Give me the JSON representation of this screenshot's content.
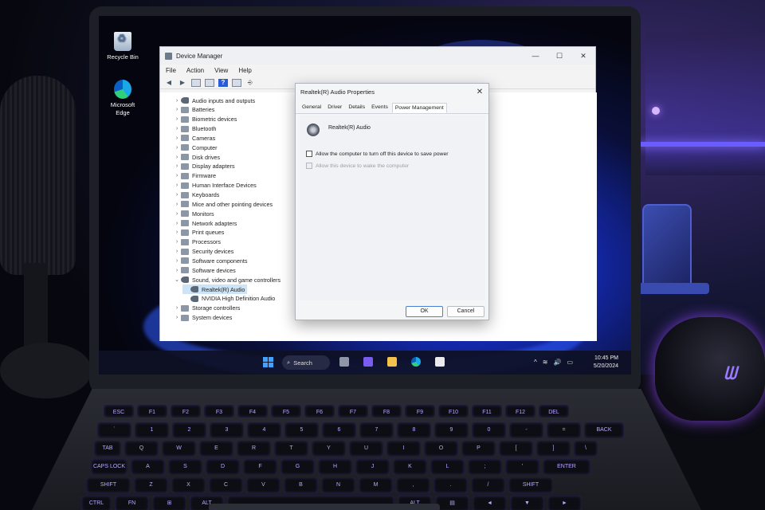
{
  "desktop": {
    "icons": [
      {
        "label": "Recycle Bin"
      },
      {
        "label": "Microsoft Edge"
      }
    ]
  },
  "device_manager": {
    "title": "Device Manager",
    "window_controls": {
      "minimize": "—",
      "maximize": "☐",
      "close": "✕"
    },
    "menu": [
      "File",
      "Action",
      "View",
      "Help"
    ],
    "tree": [
      {
        "label": "Audio inputs and outputs",
        "expander": "›"
      },
      {
        "label": "Batteries",
        "expander": "›"
      },
      {
        "label": "Biometric devices",
        "expander": "›"
      },
      {
        "label": "Bluetooth",
        "expander": "›"
      },
      {
        "label": "Cameras",
        "expander": "›"
      },
      {
        "label": "Computer",
        "expander": "›"
      },
      {
        "label": "Disk drives",
        "expander": "›"
      },
      {
        "label": "Display adapters",
        "expander": "›"
      },
      {
        "label": "Firmware",
        "expander": "›"
      },
      {
        "label": "Human Interface Devices",
        "expander": "›"
      },
      {
        "label": "Keyboards",
        "expander": "›"
      },
      {
        "label": "Mice and other pointing devices",
        "expander": "›"
      },
      {
        "label": "Monitors",
        "expander": "›"
      },
      {
        "label": "Network adapters",
        "expander": "›"
      },
      {
        "label": "Print queues",
        "expander": "›"
      },
      {
        "label": "Processors",
        "expander": "›"
      },
      {
        "label": "Security devices",
        "expander": "›"
      },
      {
        "label": "Software components",
        "expander": "›"
      },
      {
        "label": "Software devices",
        "expander": "›"
      },
      {
        "label": "Sound, video and game controllers",
        "expander": "⌄"
      },
      {
        "label": "Realtek(R) Audio",
        "expander": ""
      },
      {
        "label": "NVIDIA High Definition Audio",
        "expander": ""
      },
      {
        "label": "Storage controllers",
        "expander": "›"
      },
      {
        "label": "System devices",
        "expander": "›"
      }
    ]
  },
  "properties_dialog": {
    "title": "Realtek(R) Audio Properties",
    "close": "✕",
    "tabs": [
      "General",
      "Driver",
      "Details",
      "Events",
      "Power Management"
    ],
    "active_tab": "Power Management",
    "device_name": "Realtek(R) Audio",
    "options": [
      {
        "label": "Allow the computer to turn off this device to save power",
        "checked": false,
        "enabled": true
      },
      {
        "label": "Allow this device to wake the computer",
        "checked": false,
        "enabled": false
      }
    ],
    "ok_label": "OK",
    "cancel_label": "Cancel"
  },
  "taskbar": {
    "search_label": "Search",
    "tray_icons": [
      "^",
      "≋",
      "🔊",
      "▭"
    ],
    "time": "10:45 PM",
    "date": "5/20/2024"
  },
  "keyboard": {
    "rows": [
      [
        "ESC",
        "F1",
        "F2",
        "F3",
        "F4",
        "F5",
        "F6",
        "F7",
        "F8",
        "F9",
        "F10",
        "F11",
        "F12",
        "DEL"
      ],
      [
        "`",
        "1",
        "2",
        "3",
        "4",
        "5",
        "6",
        "7",
        "8",
        "9",
        "0",
        "-",
        "=",
        "BACK"
      ],
      [
        "TAB",
        "Q",
        "W",
        "E",
        "R",
        "T",
        "Y",
        "U",
        "I",
        "O",
        "P",
        "[",
        "]",
        "\\"
      ],
      [
        "CAPS LOCK",
        "A",
        "S",
        "D",
        "F",
        "G",
        "H",
        "J",
        "K",
        "L",
        ";",
        "'",
        "ENTER"
      ],
      [
        "SHIFT",
        "Z",
        "X",
        "C",
        "V",
        "B",
        "N",
        "M",
        ",",
        ".",
        "/",
        "SHIFT"
      ],
      [
        "CTRL",
        "FN",
        "⊞",
        "ALT",
        "",
        "ALT",
        "▤",
        "◄",
        "▼",
        "►"
      ]
    ]
  },
  "colors": {
    "accent": "#2a5bd7",
    "keyboard_glow": "#b9a7ff",
    "selection": "#cce4f7"
  }
}
